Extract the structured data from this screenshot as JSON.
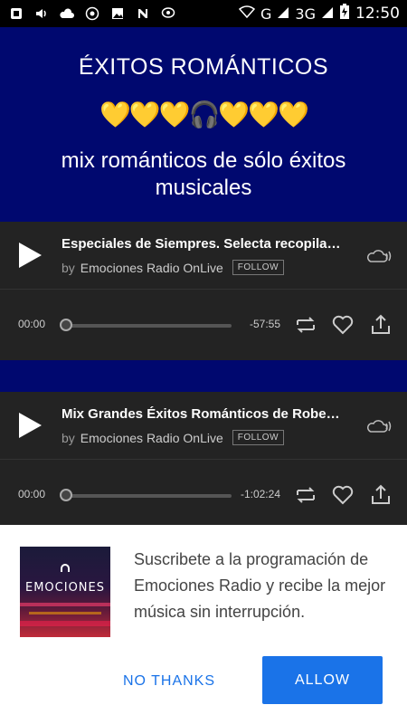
{
  "status_bar": {
    "left_icons": [
      "notification-icon",
      "volume-icon",
      "cloud-icon",
      "whatsapp-icon",
      "image-icon",
      "n-app-icon",
      "chat-icon"
    ],
    "network": "G",
    "network2": "3G",
    "time": "12:50"
  },
  "hero": {
    "title": "ÉXITOS ROMÁNTICOS",
    "emoji_line": "💛💛💛🎧💛💛💛",
    "subtitle": "mix románticos de sólo éxitos musicales"
  },
  "players": [
    {
      "title": "Especiales de Siempres. Selecta recopila…",
      "by": "by",
      "author": "Emociones Radio OnLive",
      "follow": "FOLLOW",
      "time_start": "00:00",
      "time_end": "-57:55"
    },
    {
      "title": "Mix Grandes Éxitos Románticos de Robe…",
      "by": "by",
      "author": "Emociones Radio OnLive",
      "follow": "FOLLOW",
      "time_start": "00:00",
      "time_end": "-1:02:24"
    }
  ],
  "sheet": {
    "thumb_text": "EMOCIONES",
    "message": "Suscribete a la programación de Emociones Radio y recibe la mejor música sin interrupción.",
    "no_label": "NO THANKS",
    "allow_label": "ALLOW"
  },
  "colors": {
    "page_bg": "#00086f",
    "player_bg": "#232323",
    "accent": "#1a73e8"
  }
}
